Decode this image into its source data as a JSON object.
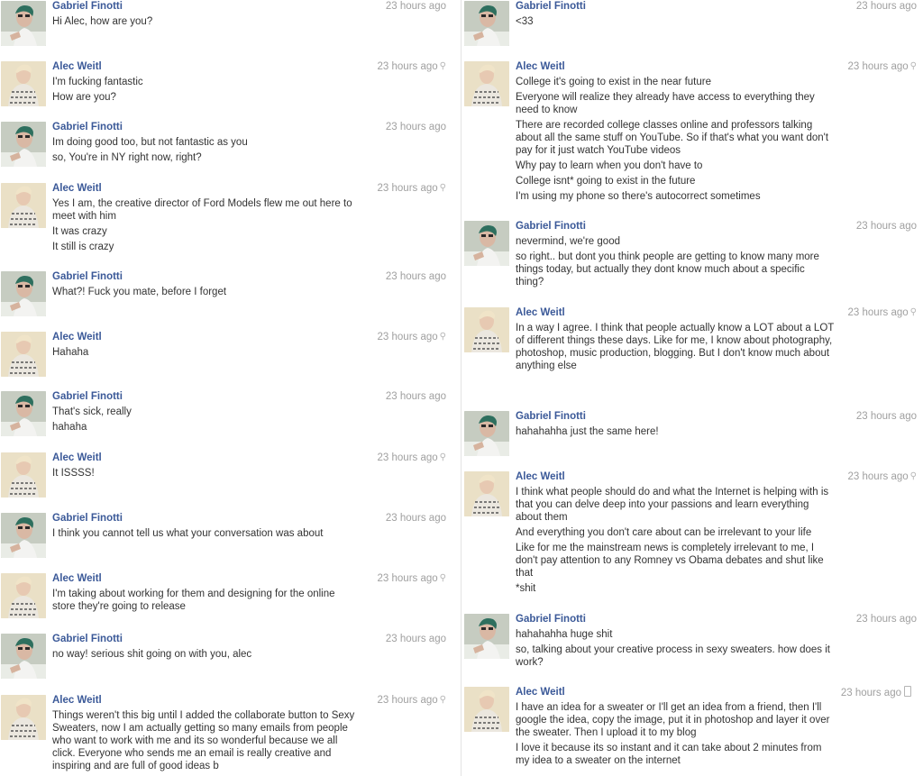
{
  "participants": {
    "gabriel": "Gabriel Finotti",
    "alec": "Alec Weitl"
  },
  "columns": [
    {
      "messages": [
        {
          "sender": "Gabriel Finotti",
          "time": "23 hours ago",
          "location": false,
          "lines": [
            "Hi Alec, how are you?"
          ]
        },
        {
          "sender": "Alec Weitl",
          "time": "23 hours ago",
          "location": true,
          "lines": [
            "I'm fucking fantastic",
            "How are you?"
          ]
        },
        {
          "sender": "Gabriel Finotti",
          "time": "23 hours ago",
          "location": false,
          "lines": [
            "Im doing good too, but not fantastic as you",
            "so, You're in NY right now, right?"
          ]
        },
        {
          "sender": "Alec Weitl",
          "time": "23 hours ago",
          "location": true,
          "lines": [
            "Yes I am, the creative director of Ford Models flew me out here to meet with him",
            "It was crazy",
            "It still is crazy"
          ]
        },
        {
          "sender": "Gabriel Finotti",
          "time": "23 hours ago",
          "location": false,
          "lines": [
            "What?! Fuck you mate, before I forget"
          ]
        },
        {
          "sender": "Alec Weitl",
          "time": "23 hours ago",
          "location": true,
          "lines": [
            "Hahaha"
          ]
        },
        {
          "sender": "Gabriel Finotti",
          "time": "23 hours ago",
          "location": false,
          "lines": [
            "That's sick, really",
            "hahaha"
          ]
        },
        {
          "sender": "Alec Weitl",
          "time": "23 hours ago",
          "location": true,
          "lines": [
            "It ISSSS!"
          ]
        },
        {
          "sender": "Gabriel Finotti",
          "time": "23 hours ago",
          "location": false,
          "lines": [
            "I think you cannot tell us what your conversation was about"
          ]
        },
        {
          "sender": "Alec Weitl",
          "time": "23 hours ago",
          "location": true,
          "lines": [
            "I'm taking about working for them and designing for the online store they're going to release"
          ]
        },
        {
          "sender": "Gabriel Finotti",
          "time": "23 hours ago",
          "location": false,
          "lines": [
            "no way! serious shit going on with you, alec"
          ]
        },
        {
          "sender": "Alec Weitl",
          "time": "23 hours ago",
          "location": true,
          "lines": [
            "Things weren't this big until I added the collaborate button to Sexy Sweaters, now I am actually getting so many emails from people who want to work with me and its so wonderful because we all click. Everyone who sends me an email is really creative and inspiring and are full of good ideas b"
          ]
        }
      ]
    },
    {
      "messages": [
        {
          "sender": "Gabriel Finotti",
          "time": "23 hours ago",
          "location": false,
          "lines": [
            "<33"
          ]
        },
        {
          "sender": "Alec Weitl",
          "time": "23 hours ago",
          "location": true,
          "lines": [
            "College it's going to exist in the near future",
            "Everyone will realize they already have access to everything they need to know",
            "There are recorded college classes online and professors talking about all the same stuff on YouTube. So if that's what you want don't pay for it just watch YouTube videos",
            "Why pay to learn when you don't have to",
            "College isnt* going to exist in the future",
            "I'm using my phone so there's autocorrect sometimes"
          ]
        },
        {
          "sender": "Gabriel Finotti",
          "time": "23 hours ago",
          "location": false,
          "lines": [
            "nevermind, we're good",
            "so right.. but dont you think people are getting to know many more things today, but actually they dont know much about a specific thing?"
          ]
        },
        {
          "sender": "Alec Weitl",
          "time": "23 hours ago",
          "location": true,
          "lines": [
            "In a way I agree. I think that people actually know a LOT about a LOT of different things these days. Like for me, I know about photography, photoshop, music production, blogging. But I don't know much about anything else"
          ]
        },
        {
          "sender": "Gabriel Finotti",
          "time": "23 hours ago",
          "location": false,
          "lines": [
            "hahahahha just the same here!"
          ]
        },
        {
          "sender": "Alec Weitl",
          "time": "23 hours ago",
          "location": true,
          "lines": [
            "I think what people should do and what the Internet is helping with is that you can delve deep into your passions and learn everything about them",
            "And everything you don't care about can be irrelevant to your life",
            "Like for me the mainstream news is completely irrelevant to me, I don't pay attention to any Romney vs Obama debates and shut like that",
            "*shit"
          ]
        },
        {
          "sender": "Gabriel Finotti",
          "time": "23 hours ago",
          "location": false,
          "lines": [
            "hahahahha huge shit",
            "so, talking about your creative process in sexy sweaters. how does it work?"
          ]
        },
        {
          "sender": "Alec Weitl",
          "time": "23 hours ago",
          "location": true,
          "mobile": true,
          "lines": [
            "I have an idea for a sweater or I'll get an idea from a friend, then I'll google the idea, copy the image, put it in photoshop and layer it over the sweater. Then I upload it to my blog",
            "I love it because its so instant and it can take about 2 minutes from my idea to a sweater on the internet"
          ]
        }
      ]
    }
  ]
}
